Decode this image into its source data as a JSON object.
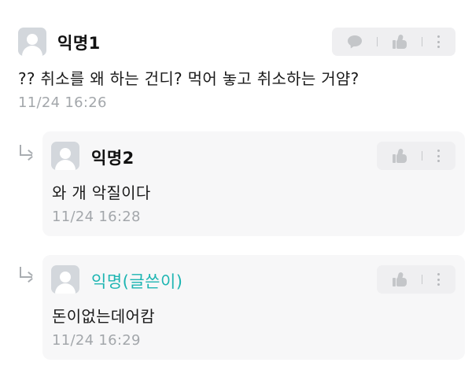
{
  "comments": [
    {
      "author": "익명1",
      "text": "?? 취소를 왜 하는 건디? 먹어 놓고 취소하는 거얌?",
      "time": "11/24 16:26",
      "actions": [
        "chat-bubble-icon",
        "thumbs-up-icon",
        "more-vertical-icon"
      ]
    }
  ],
  "replies": [
    {
      "author": "익명2",
      "text": "와 개 악질이다",
      "time": "11/24 16:28",
      "is_op": false,
      "actions": [
        "thumbs-up-icon",
        "more-vertical-icon"
      ]
    },
    {
      "author": "익명(글쓴이)",
      "text": "돈이없는데어캄",
      "time": "11/24 16:29",
      "is_op": true,
      "actions": [
        "thumbs-up-icon",
        "more-vertical-icon"
      ]
    }
  ],
  "colors": {
    "op_name": "#1db5b2",
    "timestamp": "#a3a7ab",
    "reply_card": "#f7f7f8",
    "action_bar": "#efeff1"
  }
}
